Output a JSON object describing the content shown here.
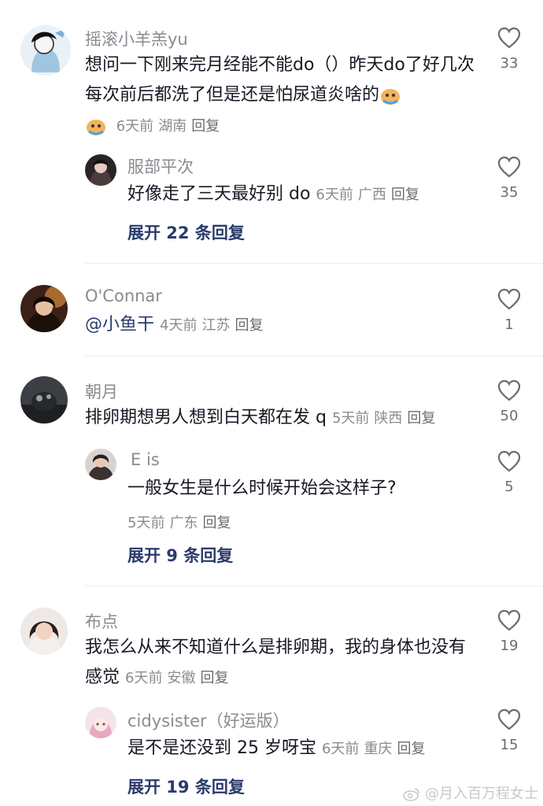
{
  "comments": [
    {
      "user": "摇滚小羊羔yu",
      "text": "想问一下刚来完月经能不能do（）昨天do了好几次每次前后都洗了但是还是怕尿道炎啥的",
      "time": "6天前",
      "location": "湖南",
      "reply": "回复",
      "likes": "33",
      "replies": [
        {
          "user": "服部平次",
          "text": "好像走了三天最好别 do",
          "time": "6天前",
          "location": "广西",
          "reply": "回复",
          "likes": "35"
        }
      ],
      "expand": "展开 22 条回复"
    },
    {
      "user": "O'Connar",
      "text": "@小鱼干",
      "time": "4天前",
      "location": "江苏",
      "reply": "回复",
      "likes": "1"
    },
    {
      "user": "朝月",
      "text": "排卵期想男人想到白天都在发 q",
      "time": "5天前",
      "location": "陕西",
      "reply": "回复",
      "likes": "50",
      "replies": [
        {
          "user": "E is",
          "text": "一般女生是什么时候开始会这样子?",
          "time": "5天前",
          "location": "广东",
          "reply": "回复",
          "likes": "5"
        }
      ],
      "expand": "展开 9 条回复"
    },
    {
      "user": "布点",
      "text": "我怎么从来不知道什么是排卵期，我的身体也没有感觉",
      "time": "6天前",
      "location": "安徽",
      "reply": "回复",
      "likes": "19",
      "replies": [
        {
          "user": "cidysister（好运版）",
          "text": "是不是还没到 25 岁呀宝",
          "time": "6天前",
          "location": "重庆",
          "reply": "回复",
          "likes": "15"
        }
      ],
      "expand": "展开 19 条回复"
    }
  ],
  "watermark": "@月入百万程女士",
  "icons": {
    "like": "heart-outline-icon",
    "emoji": "crying-emoji-icon",
    "weibo": "weibo-logo-icon"
  }
}
